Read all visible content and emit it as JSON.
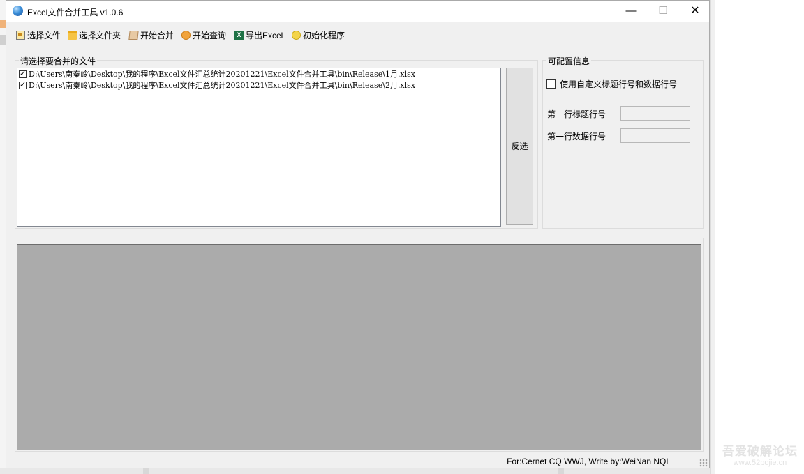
{
  "window": {
    "title": "Excel文件合并工具 v1.0.6",
    "controls": {
      "minimize": "—",
      "maximize": "☐",
      "close": "✕"
    }
  },
  "toolbar": {
    "items": [
      {
        "label": "选择文件",
        "icon": "file-icon"
      },
      {
        "label": "选择文件夹",
        "icon": "folder-icon"
      },
      {
        "label": "开始合并",
        "icon": "merge-box-icon"
      },
      {
        "label": "开始查询",
        "icon": "search-icon"
      },
      {
        "label": "导出Excel",
        "icon": "excel-icon"
      },
      {
        "label": "初始化程序",
        "icon": "reset-icon"
      }
    ]
  },
  "files_group": {
    "title": "请选择要合并的文件",
    "files": [
      {
        "checked": true,
        "path": "D:\\Users\\南秦岭\\Desktop\\我的程序\\Excel文件汇总统计20201221\\Excel文件合并工具\\bin\\Release\\1月.xlsx"
      },
      {
        "checked": true,
        "path": "D:\\Users\\南秦岭\\Desktop\\我的程序\\Excel文件汇总统计20201221\\Excel文件合并工具\\bin\\Release\\2月.xlsx"
      }
    ],
    "invert_label": "反选"
  },
  "config_group": {
    "title": "可配置信息",
    "custom_rows_label": "使用自定义标题行号和数据行号",
    "custom_rows_checked": false,
    "title_row_label": "第一行标题行号",
    "title_row_value": "",
    "data_row_label": "第一行数据行号",
    "data_row_value": ""
  },
  "status": {
    "text": "For:Cernet CQ WWJ, Write by:WeiNan NQL"
  },
  "watermark": {
    "line1": "吾爱破解论坛",
    "line2": "www.52pojie.cn"
  }
}
